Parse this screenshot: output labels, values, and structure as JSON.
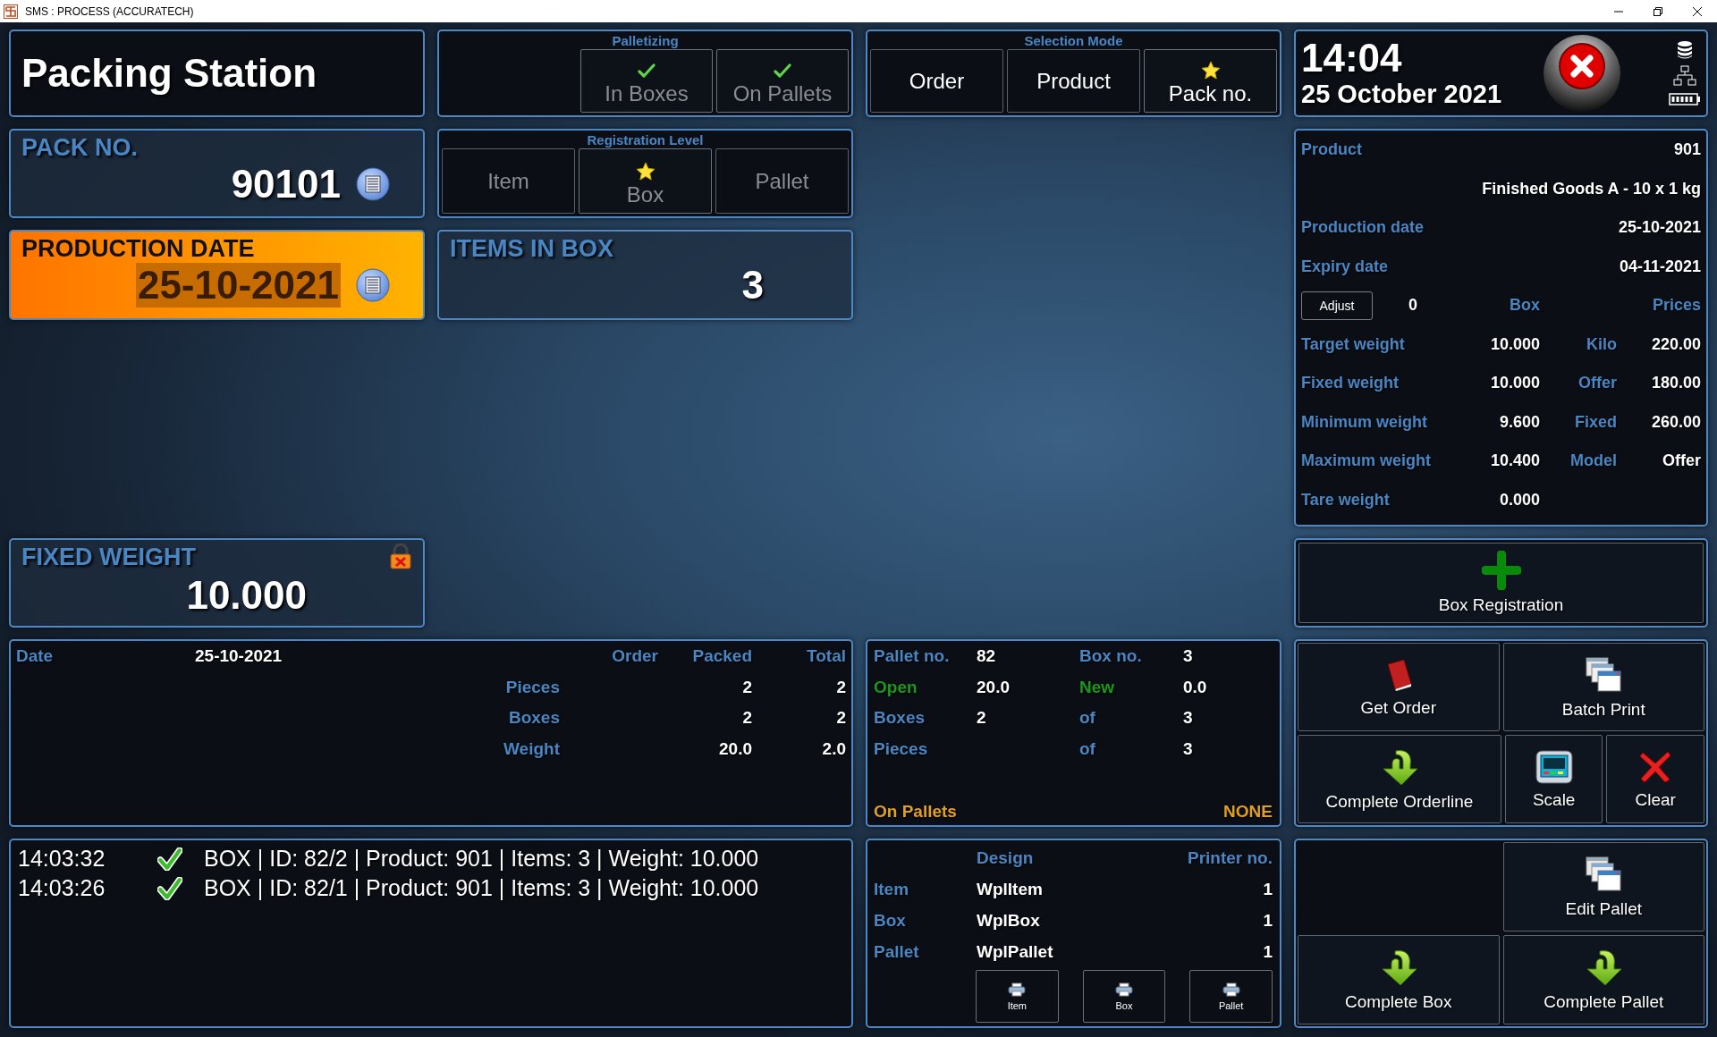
{
  "window": {
    "title": "SMS : PROCESS (ACCURATECH)"
  },
  "station": {
    "title": "Packing Station"
  },
  "palletizing": {
    "title": "Palletizing",
    "options": [
      {
        "label": "In Boxes",
        "checked": true,
        "disabled": true
      },
      {
        "label": "On Pallets",
        "checked": true,
        "disabled": true
      }
    ]
  },
  "selection_mode": {
    "title": "Selection Mode",
    "options": [
      {
        "label": "Order",
        "selected": false
      },
      {
        "label": "Product",
        "selected": false
      },
      {
        "label": "Pack no.",
        "selected": true
      }
    ]
  },
  "clock": {
    "time": "14:04",
    "date": "25 October 2021"
  },
  "pack_no": {
    "title": "PACK NO.",
    "value": "90101"
  },
  "registration_level": {
    "title": "Registration Level",
    "options": [
      {
        "label": "Item",
        "selected": false,
        "disabled": true
      },
      {
        "label": "Box",
        "selected": true,
        "disabled": true
      },
      {
        "label": "Pallet",
        "selected": false,
        "disabled": true
      }
    ]
  },
  "production_date": {
    "title": "PRODUCTION DATE",
    "value": "25-10-2021",
    "highlighted": true
  },
  "items_in_box": {
    "title": "ITEMS IN BOX",
    "value": "3"
  },
  "fixed_weight": {
    "title": "FIXED WEIGHT",
    "value": "10.000",
    "locked": true
  },
  "product_info": {
    "rows": [
      {
        "kind": "pair",
        "label": "Product",
        "value": "901"
      },
      {
        "kind": "text",
        "value": "Finished Goods A - 10 x 1 kg"
      },
      {
        "kind": "pair",
        "label": "Production date",
        "value": "25-10-2021"
      },
      {
        "kind": "pair",
        "label": "Expiry date",
        "value": "04-11-2021"
      },
      {
        "kind": "adjust",
        "button": "Adjust",
        "value": "0",
        "headers": [
          "Box",
          "Prices"
        ]
      },
      {
        "kind": "weight",
        "label": "Target weight",
        "value": "10.000",
        "label2": "Kilo",
        "value2": "220.00"
      },
      {
        "kind": "weight",
        "label": "Fixed weight",
        "value": "10.000",
        "label2": "Offer",
        "value2": "180.00"
      },
      {
        "kind": "weight",
        "label": "Minimum weight",
        "value": "9.600",
        "label2": "Fixed",
        "value2": "260.00"
      },
      {
        "kind": "weight",
        "label": "Maximum weight",
        "value": "10.400",
        "label2": "Model",
        "value2": "Offer"
      },
      {
        "kind": "weight",
        "label": "Tare weight",
        "value": "0.000"
      }
    ]
  },
  "box_registration": {
    "label": "Box Registration"
  },
  "order_stats": {
    "date_label": "Date",
    "date": "25-10-2021",
    "columns": [
      "Order",
      "Packed",
      "Total"
    ],
    "rows": [
      {
        "label": "Pieces",
        "packed": "2",
        "total": "2"
      },
      {
        "label": "Boxes",
        "packed": "2",
        "total": "2"
      },
      {
        "label": "Weight",
        "packed": "20.0",
        "total": "2.0"
      }
    ]
  },
  "pallet": {
    "rows": [
      {
        "label": {
          "text": "Pallet no.",
          "kind": "plain"
        },
        "value": "82",
        "label2": {
          "text": "Box no.",
          "kind": "plain"
        },
        "value2": "3"
      },
      {
        "label": {
          "text": "Open",
          "kind": "status"
        },
        "value": "20.0",
        "label2": {
          "text": "New",
          "kind": "status"
        },
        "value2": "0.0"
      },
      {
        "label": {
          "text": "Boxes",
          "kind": "plain"
        },
        "value": "2",
        "label2": {
          "text": "of",
          "kind": "plain"
        },
        "value2": "3"
      },
      {
        "label": {
          "text": "Pieces",
          "kind": "plain"
        },
        "label2": {
          "text": "of",
          "kind": "plain"
        },
        "value2": "3"
      }
    ],
    "footer": {
      "label": "On Pallets",
      "value": "NONE"
    }
  },
  "log": [
    {
      "time": "14:03:32",
      "ok": true,
      "message": "BOX | ID: 82/2 | Product: 901 | Items: 3 | Weight: 10.000"
    },
    {
      "time": "14:03:26",
      "ok": true,
      "message": "BOX | ID: 82/1 | Product: 901 | Items: 3 | Weight: 10.000"
    }
  ],
  "printers": {
    "columns": [
      "Design",
      "Printer no."
    ],
    "rows": [
      {
        "label": "Item",
        "design": "WplItem",
        "printer": "1"
      },
      {
        "label": "Box",
        "design": "WplBox",
        "printer": "1"
      },
      {
        "label": "Pallet",
        "design": "WplPallet",
        "printer": "1"
      }
    ],
    "buttons": [
      "Item",
      "Box",
      "Pallet"
    ]
  },
  "actions": [
    [
      {
        "label": "Get Order",
        "kind": "book"
      },
      {
        "label": "Batch Print",
        "kind": "windows"
      }
    ],
    [
      {
        "label": "Complete Orderline",
        "kind": "arrow"
      },
      {
        "label": "Scale",
        "kind": "scale"
      },
      {
        "label": "Clear",
        "kind": "cross"
      }
    ]
  ],
  "pallet_actions": [
    {
      "label": "Edit Pallet",
      "kind": "windows"
    },
    {
      "label": "Complete Box",
      "kind": "arrow"
    },
    {
      "label": "Complete Pallet",
      "kind": "arrow"
    }
  ]
}
